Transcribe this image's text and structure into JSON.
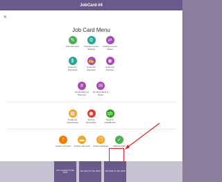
{
  "topbar": {
    "title": "JobCard #4"
  },
  "modal": {
    "close_glyph": "×",
    "title": "Job Card Menu",
    "rows": [
      {
        "items": [
          {
            "label": "Edit Job Card",
            "icon": "pencil-icon",
            "glyph": "✎",
            "color": "#4caf50"
          },
          {
            "label": "Change Invoice Settings",
            "icon": "gear-icon",
            "glyph": "⚙",
            "color": "#26a69a"
          },
          {
            "label": "Change Invoice Status",
            "icon": "status-icon",
            "glyph": "⇄",
            "color": "#ab47bc"
          }
        ]
      },
      {
        "items": [
          {
            "label": "Customer Payments",
            "icon": "payment-icon",
            "glyph": "$",
            "color": "#26a69a"
          },
          {
            "label": "Customer Signature",
            "icon": "signature-icon",
            "glyph": "✍",
            "color": "#ab47bc"
          },
          {
            "label": "Customer Pictures",
            "icon": "camera-icon",
            "glyph": "◉",
            "color": "#ab47bc"
          }
        ]
      },
      {
        "items": [
          {
            "label": "My Numbers & Payment",
            "icon": "numbers-icon",
            "glyph": "#",
            "color": "#ab47bc"
          },
          {
            "label": "My Reminders & Notes",
            "icon": "notes-icon",
            "glyph": "✉",
            "color": "#ab47bc"
          }
        ]
      },
      {
        "items": [
          {
            "label": "Create an Appointment",
            "icon": "calendar-icon",
            "glyph": "▦",
            "color": "#f5a623"
          },
          {
            "label": "Service Reminders",
            "icon": "reminder-icon",
            "glyph": "⏰",
            "color": "#e53935"
          },
          {
            "label": "Send to QuickBooks",
            "icon": "quickbooks-icon",
            "glyph": "qb",
            "color": "#2ca01c"
          }
        ]
      },
      {
        "items": [
          {
            "label": "Delete Job Card",
            "icon": "delete-icon",
            "glyph": "!",
            "color": "#f57c00"
          },
          {
            "label": "Archive Job Card",
            "icon": "folder-icon",
            "glyph": "▬",
            "color": "#f5a623"
          },
          {
            "label": "Create Duplicate",
            "icon": "duplicate-icon",
            "glyph": "❐",
            "color": "#f5a623"
          },
          {
            "label": "Mark as Paid",
            "icon": "check-icon",
            "glyph": "✓",
            "color": "#4caf50"
          }
        ]
      }
    ]
  },
  "bottombar": {
    "segments": [
      {
        "label": "Job Created Fri Jan 2023"
      },
      {
        "label": "Job Sent Fri Jan 2023"
      },
      {
        "label": "Job Paid Fri Jan 2023"
      }
    ]
  },
  "colors": {
    "accent": "#6a5a8c",
    "highlight": "#e02020"
  }
}
